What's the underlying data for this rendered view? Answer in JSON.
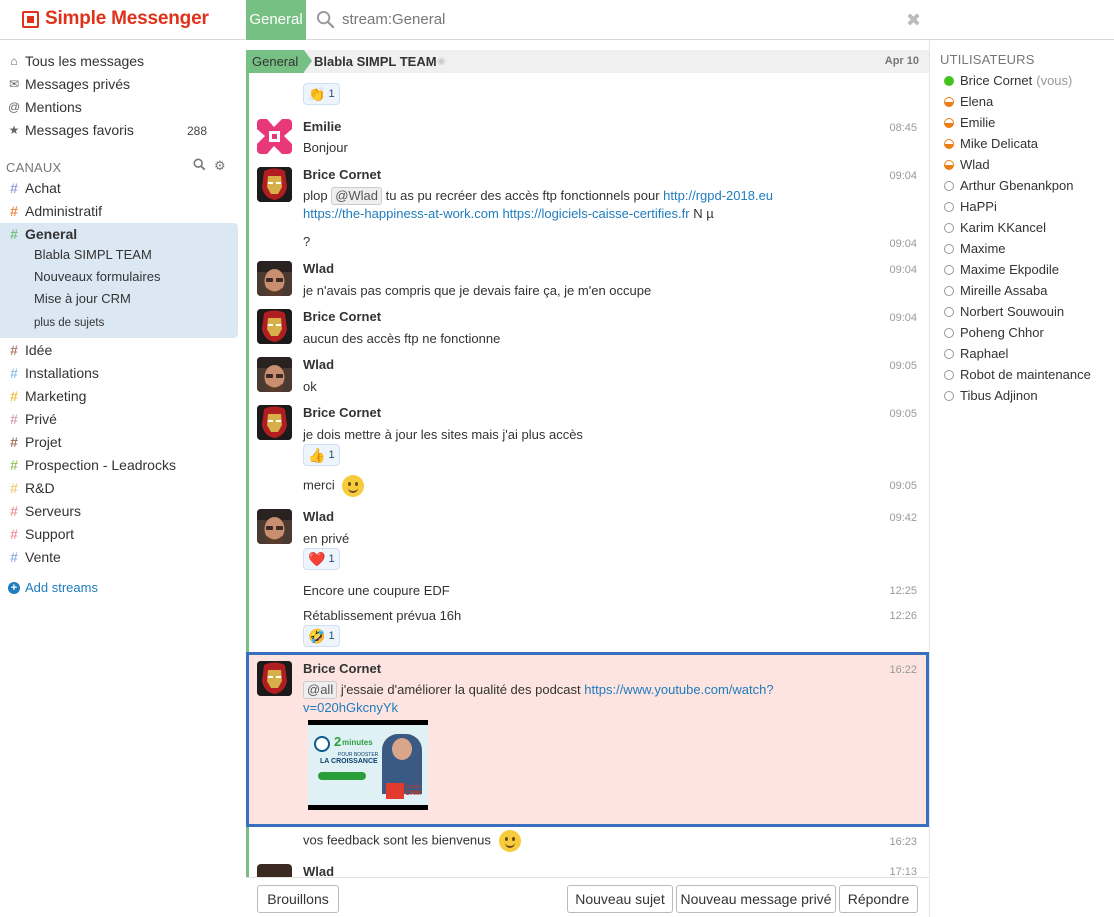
{
  "app": {
    "title": "Simple Messenger",
    "brand_color": "#e0321b"
  },
  "header": {
    "stream_tab": "General",
    "search_text": "stream:General",
    "close_icon": "close-icon"
  },
  "sidebar": {
    "nav": [
      {
        "label": "Tous les messages",
        "icon": "home-icon"
      },
      {
        "label": "Messages privés",
        "icon": "envelope-icon"
      },
      {
        "label": "Mentions",
        "icon": "at-icon"
      },
      {
        "label": "Messages favoris",
        "icon": "star-icon",
        "count": "288"
      }
    ],
    "channels_label": "CANAUX",
    "streams": [
      {
        "name": "Achat",
        "color": "#9aa3dd"
      },
      {
        "name": "Administratif",
        "color": "#ec8944"
      },
      {
        "name": "General",
        "color": "#76c083",
        "active": true
      },
      {
        "name": "Idée",
        "color": "#b67f75"
      },
      {
        "name": "Installations",
        "color": "#97c4e6"
      },
      {
        "name": "Marketing",
        "color": "#f2c24b"
      },
      {
        "name": "Privé",
        "color": "#d7a7b5"
      },
      {
        "name": "Projet",
        "color": "#a6745f"
      },
      {
        "name": "Prospection - Leadrocks",
        "color": "#9bc66e"
      },
      {
        "name": "R&D",
        "color": "#f4cd79"
      },
      {
        "name": "Serveurs",
        "color": "#ef9ba0"
      },
      {
        "name": "Support",
        "color": "#ef9ba0"
      },
      {
        "name": "Vente",
        "color": "#9ab1e0"
      }
    ],
    "topics": [
      "Blabla SIMPL TEAM",
      "Nouveaux formulaires",
      "Mise à jour CRM"
    ],
    "more_topics": "plus de sujets",
    "add_streams": "Add streams"
  },
  "recipient": {
    "stream": "General",
    "topic": "Blabla SIMPL TEAM",
    "date": "Apr 10"
  },
  "messages": [
    {
      "sender": "Emilie",
      "time": "08:45",
      "text": "Bonjour"
    },
    {
      "sender": "Brice Cornet",
      "time": "09:04",
      "pre": "plop",
      "mention": "@Wlad",
      "mid": "tu as pu recréer des accès ftp fonctionnels pour",
      "link1": "http://rgpd-2018.eu",
      "link2": "https://the-happiness-at-work.com",
      "link3": "https://logiciels-caisse-certifies.fr",
      "tail": "N µ"
    },
    {
      "time": "09:04",
      "text": "?"
    },
    {
      "sender": "Wlad",
      "time": "09:04",
      "text": "je n'avais pas compris que je devais faire ça, je m'en occupe"
    },
    {
      "sender": "Brice Cornet",
      "time": "09:04",
      "text": "aucun des accès ftp ne fonctionne"
    },
    {
      "sender": "Wlad",
      "time": "09:05",
      "text": "ok"
    },
    {
      "sender": "Brice Cornet",
      "time": "09:05",
      "text": "je dois mettre à jour les sites mais j'ai plus accès"
    },
    {
      "time": "09:05",
      "text": "merci"
    },
    {
      "sender": "Wlad",
      "time": "09:42",
      "text": "en privé"
    },
    {
      "time": "12:25",
      "text": "Encore une coupure EDF"
    },
    {
      "time": "12:26",
      "text": "Rétablissement prévua 16h"
    },
    {
      "sender": "Brice Cornet",
      "time": "16:22",
      "mention": "@all",
      "text": "j'essaie d'améliorer la qualité des podcast",
      "link1": "https://www.youtube.com/watch?",
      "link2": "v=020hGkcnyYk"
    },
    {
      "time": "16:23",
      "text": "vos feedback sont les bienvenus"
    },
    {
      "sender": "Wlad",
      "time": "17:13"
    }
  ],
  "reactions": [
    {
      "emoji": "👏",
      "count": "1"
    },
    {
      "emoji": "👍",
      "count": "1"
    },
    {
      "emoji": "❤️",
      "count": "1"
    },
    {
      "emoji": "🤣",
      "count": "1"
    }
  ],
  "thumbnail": {
    "line1": "2",
    "line2": "minutes",
    "line3": "POUR BOOSTER",
    "line4": "LA CROISSANCE",
    "line5": "Simple",
    "line6": "CRM"
  },
  "compose": {
    "drafts": "Brouillons",
    "new_topic": "Nouveau sujet",
    "new_pm": "Nouveau message privé",
    "reply": "Répondre"
  },
  "users": {
    "heading": "UTILISATEURS",
    "list": [
      {
        "name": "Brice Cornet",
        "status": "active",
        "suffix": "(vous)"
      },
      {
        "name": "Elena",
        "status": "idle"
      },
      {
        "name": "Emilie",
        "status": "idle"
      },
      {
        "name": "Mike Delicata",
        "status": "idle"
      },
      {
        "name": "Wlad",
        "status": "idle"
      },
      {
        "name": "Arthur Gbenankpon",
        "status": "offline"
      },
      {
        "name": "HaPPi",
        "status": "offline"
      },
      {
        "name": "Karim KKancel",
        "status": "offline"
      },
      {
        "name": "Maxime",
        "status": "offline"
      },
      {
        "name": "Maxime Ekpodile",
        "status": "offline"
      },
      {
        "name": "Mireille Assaba",
        "status": "offline"
      },
      {
        "name": "Norbert Souwouin",
        "status": "offline"
      },
      {
        "name": "Poheng Chhor",
        "status": "offline"
      },
      {
        "name": "Raphael",
        "status": "offline"
      },
      {
        "name": "Robot de maintenance",
        "status": "offline"
      },
      {
        "name": "Tibus Adjinon",
        "status": "offline"
      }
    ]
  }
}
